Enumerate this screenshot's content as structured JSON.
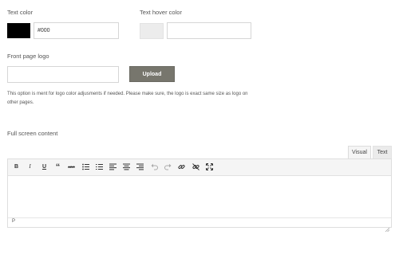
{
  "text_color": {
    "label": "Text color",
    "swatch_color": "#000000",
    "value": "#000"
  },
  "text_hover_color": {
    "label": "Text hover color",
    "swatch_color": "#ececec",
    "value": ""
  },
  "front_page_logo": {
    "label": "Front page logo",
    "value": "",
    "upload_label": "Upload",
    "help_line1": "This option is ment for logo color adjusments if needed. Please make sure, the logo is exact same size as logo on",
    "help_line2": "other pages."
  },
  "full_screen_content": {
    "label": "Full screen content",
    "tabs": [
      "Visual",
      "Text"
    ],
    "toolbar": {
      "bold": "B",
      "italic": "I",
      "underline": "U",
      "quote": "“",
      "strikethrough": "ABC"
    },
    "status_path": "P"
  }
}
